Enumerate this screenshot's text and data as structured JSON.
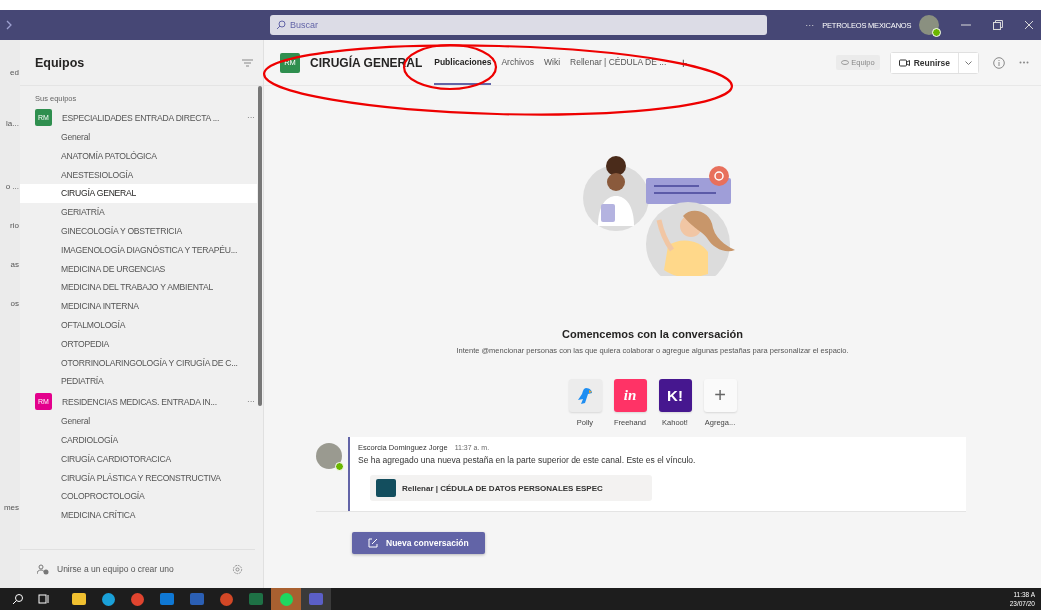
{
  "titlebar": {
    "search_placeholder": "Buscar",
    "more": "···",
    "org": "PETROLEOS MEXICANOS"
  },
  "rail": {
    "labels": [
      "ed",
      "la...",
      "o ...",
      "rio",
      "as",
      "os",
      "mes"
    ]
  },
  "sidebar": {
    "title": "Equipos",
    "section": "Sus equipos",
    "teams": [
      {
        "initials": "RM",
        "name": "ESPECIALIDADES ENTRADA DIRECTA ...",
        "more": "···",
        "color": "#2f8f4f",
        "channels": [
          {
            "name": "General",
            "selected": false
          },
          {
            "name": "ANATOMÍA PATOLÓGICA",
            "selected": false
          },
          {
            "name": "ANESTESIOLOGÍA",
            "selected": false
          },
          {
            "name": "CIRUGÍA GENERAL",
            "selected": true
          },
          {
            "name": "GERIATRÍA",
            "selected": false
          },
          {
            "name": "GINECOLOGÍA Y OBSTETRICIA",
            "selected": false
          },
          {
            "name": "IMAGENOLOGÍA DIAGNÓSTICA Y TERAPÉU...",
            "selected": false
          },
          {
            "name": "MEDICINA DE URGENCIAS",
            "selected": false
          },
          {
            "name": "MEDICINA DEL TRABAJO Y AMBIENTAL",
            "selected": false
          },
          {
            "name": "MEDICINA INTERNA",
            "selected": false
          },
          {
            "name": "OFTALMOLOGÍA",
            "selected": false
          },
          {
            "name": "ORTOPEDIA",
            "selected": false
          },
          {
            "name": "OTORRINOLARINGOLOGÍA Y CIRUGÍA DE C...",
            "selected": false
          },
          {
            "name": "PEDIATRÍA",
            "selected": false
          }
        ]
      },
      {
        "initials": "RM",
        "name": "RESIDENCIAS MEDICAS. ENTRADA IN...",
        "more": "···",
        "color": "#e3008c",
        "channels": [
          {
            "name": "General",
            "selected": false
          },
          {
            "name": "CARDIOLOGÍA",
            "selected": false
          },
          {
            "name": "CIRUGÍA CARDIOTORACICA",
            "selected": false
          },
          {
            "name": "CIRUGÍA PLÁSTICA Y RECONSTRUCTIVA",
            "selected": false
          },
          {
            "name": "COLOPROCTOLOGÍA",
            "selected": false
          },
          {
            "name": "MEDICINA CRÍTICA",
            "selected": false
          }
        ]
      }
    ],
    "join": "Unirse a un equipo o crear uno"
  },
  "channel": {
    "initials": "RM",
    "color": "#2f8f4f",
    "title": "CIRUGÍA GENERAL",
    "tabs": [
      {
        "label": "Publicaciones",
        "selected": true
      },
      {
        "label": "Archivos",
        "selected": false
      },
      {
        "label": "Wiki",
        "selected": false
      },
      {
        "label": "Rellenar | CÉDULA DE ...",
        "selected": false
      }
    ],
    "add_tab": "+",
    "team_badge": "Equipo",
    "meet": "Reunirse"
  },
  "welcome": {
    "heading": "Comencemos con la conversación",
    "text": "Intente @mencionar personas con las que quiera colaborar o agregue algunas pestañas para personalizar el espacio."
  },
  "apps": [
    {
      "kind": "polly",
      "label": "Polly"
    },
    {
      "kind": "freehand",
      "label": "Freehand",
      "glyph": "in"
    },
    {
      "kind": "kahoot",
      "label": "Kahoot!",
      "glyph": "K!"
    },
    {
      "kind": "add",
      "label": "Agrega...",
      "glyph": "+"
    }
  ],
  "message": {
    "author": "Escorcia Dominguez Jorge",
    "time": "11:37 a. m.",
    "text": "Se ha agregado una nueva pestaña en la parte superior de este canal. Este es el vínculo.",
    "card_title": "Rellenar | CÉDULA DE DATOS PERSONALES ESPEC"
  },
  "new_conversation": "Nueva conversación",
  "taskbar": {
    "time": "11:38 A",
    "date": "23/07/20"
  }
}
